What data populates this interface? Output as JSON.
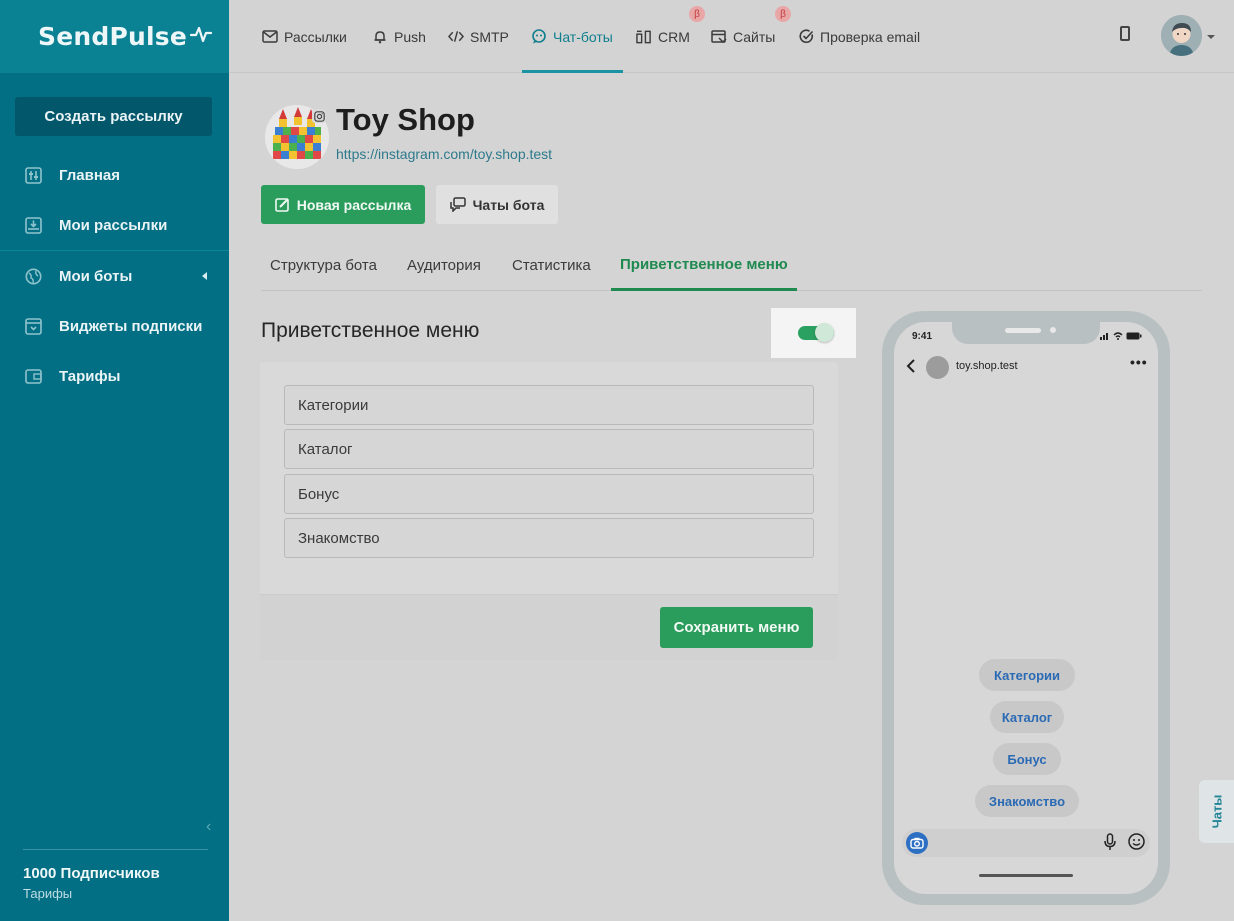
{
  "sidebar": {
    "brand": "SendPulse",
    "create_button": "Создать рассылку",
    "items": [
      {
        "label": "Главная",
        "icon": "sliders-icon"
      },
      {
        "label": "Мои рассылки",
        "icon": "inbox-icon"
      },
      {
        "label": "Мои боты",
        "icon": "globe-icon"
      },
      {
        "label": "Виджеты подписки",
        "icon": "widget-icon"
      },
      {
        "label": "Тарифы",
        "icon": "wallet-icon"
      }
    ],
    "subscribers": "1000 Подписчиков",
    "tariffs_link": "Тарифы"
  },
  "topnav": {
    "items": [
      {
        "label": "Рассылки",
        "icon": "mail-icon"
      },
      {
        "label": "Push",
        "icon": "bell-icon"
      },
      {
        "label": "SMTP",
        "icon": "code-icon"
      },
      {
        "label": "Чат-боты",
        "icon": "chatbot-icon",
        "active": true
      },
      {
        "label": "CRM",
        "icon": "crm-icon",
        "beta": true
      },
      {
        "label": "Сайты",
        "icon": "site-icon",
        "beta": true
      },
      {
        "label": "Проверка email",
        "icon": "check-circle-icon"
      }
    ],
    "beta_symbol": "β"
  },
  "bot": {
    "title": "Toy Shop",
    "url": "https://instagram.com/toy.shop.test"
  },
  "actions": {
    "new_campaign": "Новая рассылка",
    "bot_chats": "Чаты бота"
  },
  "tabs": [
    "Структура бота",
    "Аудитория",
    "Статистика",
    "Приветственное меню"
  ],
  "welcome_menu": {
    "title": "Приветственное меню",
    "enabled": true,
    "items": [
      "Категории",
      "Каталог",
      "Бонус",
      "Знакомство"
    ],
    "save_button": "Сохранить меню"
  },
  "phone": {
    "time": "9:41",
    "account": "toy.shop.test",
    "more": "•••",
    "quick_replies": [
      "Категории",
      "Каталог",
      "Бонус",
      "Знакомство"
    ]
  },
  "chats_tab": "Чаты",
  "colors": {
    "sidebar": "#036f84",
    "accent_green": "#2a9c5c",
    "active_tab": "#1e8a50",
    "link": "#2d7a8c"
  }
}
